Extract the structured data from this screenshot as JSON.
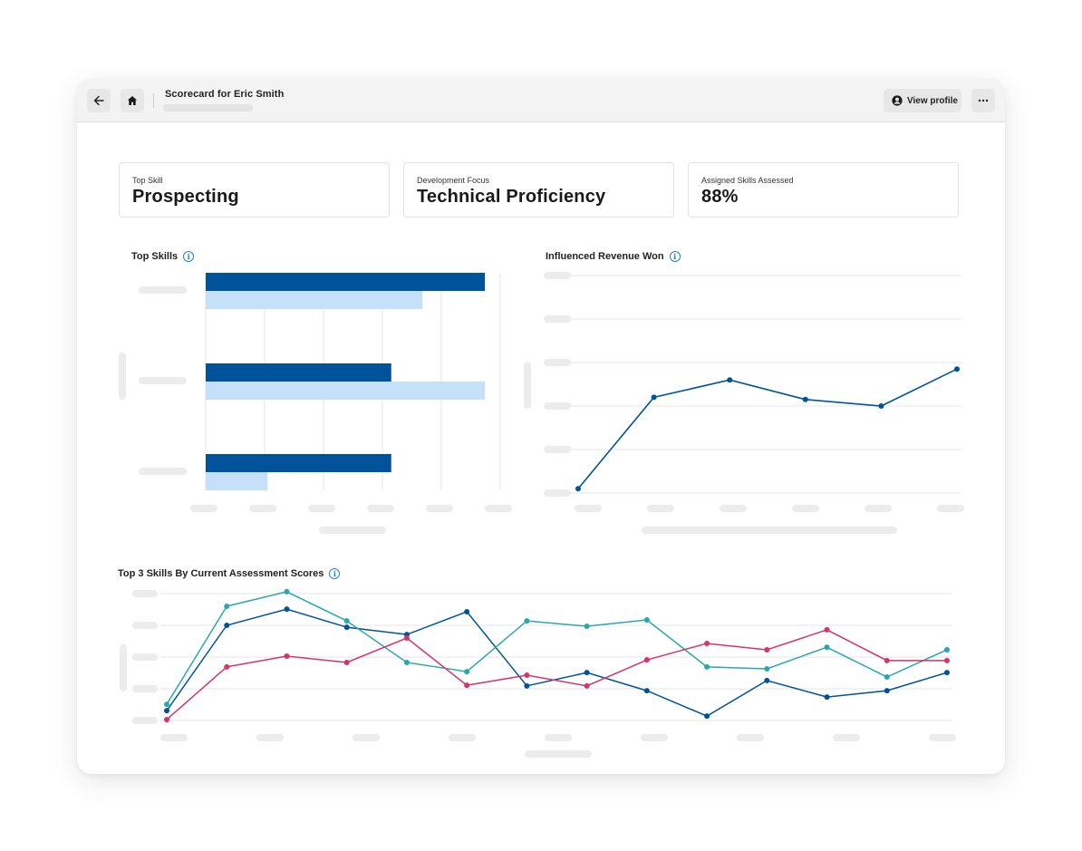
{
  "header": {
    "title": "Scorecard for Eric Smith",
    "back_icon": "arrow-left-icon",
    "home_icon": "home-icon",
    "view_profile_label": "View profile",
    "view_profile_icon": "user-circle-icon",
    "more_icon": "more-horizontal-icon",
    "more_label": "···"
  },
  "kpis": [
    {
      "label": "Top Skill",
      "value": "Prospecting"
    },
    {
      "label": "Development Focus",
      "value": "Technical Proficiency"
    },
    {
      "label": "Assigned Skills Assessed",
      "value": "88%"
    }
  ],
  "info_glyph": "i",
  "colors": {
    "primary_dark": "#00539a",
    "primary_light": "#c5e1f9",
    "teal": "#2aa7ad",
    "pink": "#d6336c",
    "info": "#1f7ed6",
    "gridline": "#e6e6e6",
    "skeleton": "#ececec"
  },
  "chart_data": [
    {
      "id": "top-skills",
      "type": "bar",
      "orientation": "horizontal",
      "title": "Top Skills",
      "categories": [
        "",
        "",
        ""
      ],
      "series": [
        {
          "name": "",
          "color": "#00539a",
          "values": [
            4.74,
            3.15,
            3.15
          ]
        },
        {
          "name": "",
          "color": "#c5e1f9",
          "values": [
            3.68,
            4.74,
            1.05
          ]
        }
      ],
      "xlim": [
        0,
        5
      ],
      "x_ticks": 6,
      "grid": true,
      "tick_labels_hidden": true,
      "xlabel": "",
      "ylabel": ""
    },
    {
      "id": "influenced-revenue",
      "type": "line",
      "title": "Influenced Revenue Won",
      "x": [
        0,
        1,
        2,
        3,
        4,
        5
      ],
      "series": [
        {
          "name": "",
          "color": "#00539a",
          "values": [
            0.1,
            2.2,
            2.6,
            2.15,
            2.0,
            2.85
          ]
        }
      ],
      "ylim": [
        0,
        5
      ],
      "y_ticks": 6,
      "x_ticks": 6,
      "grid": true,
      "tick_labels_hidden": true,
      "xlabel": "",
      "ylabel": ""
    },
    {
      "id": "top-3-skills-assessment",
      "type": "line",
      "title": "Top 3 Skills By Current Assessment Scores",
      "x": [
        0,
        1,
        2,
        3,
        4,
        5,
        6,
        7,
        8,
        9,
        10,
        11,
        12,
        13
      ],
      "series": [
        {
          "name": "",
          "color": "#00539a",
          "values": [
            0.31,
            3.0,
            3.51,
            2.94,
            2.71,
            3.43,
            1.09,
            1.51,
            0.94,
            0.14,
            1.26,
            0.74,
            0.94,
            1.51
          ]
        },
        {
          "name": "",
          "color": "#2aa7ad",
          "values": [
            0.51,
            3.6,
            4.06,
            3.14,
            1.83,
            1.54,
            3.14,
            2.97,
            3.17,
            1.69,
            1.63,
            2.31,
            1.37,
            2.23
          ]
        },
        {
          "name": "",
          "color": "#d6336c",
          "values": [
            0.03,
            1.69,
            2.03,
            1.83,
            2.6,
            1.11,
            1.43,
            1.09,
            1.91,
            2.43,
            2.23,
            2.86,
            1.89,
            1.89
          ]
        }
      ],
      "ylim": [
        0,
        4
      ],
      "y_ticks": 5,
      "x_ticks": 9,
      "grid": true,
      "tick_labels_hidden": true,
      "xlabel": "",
      "ylabel": ""
    }
  ]
}
